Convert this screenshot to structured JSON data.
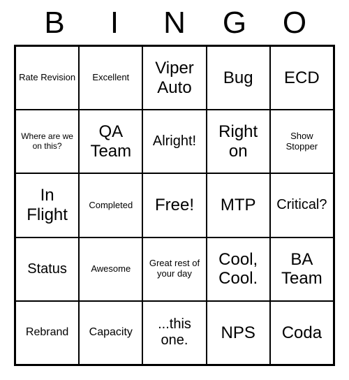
{
  "header": {
    "letters": [
      "B",
      "I",
      "N",
      "G",
      "O"
    ]
  },
  "grid": [
    [
      {
        "text": "Rate Revision",
        "size": "fs-s"
      },
      {
        "text": "Excellent",
        "size": "fs-s"
      },
      {
        "text": "Viper Auto",
        "size": "fs-xl"
      },
      {
        "text": "Bug",
        "size": "fs-xl"
      },
      {
        "text": "ECD",
        "size": "fs-xl"
      }
    ],
    [
      {
        "text": "Where are we on this?",
        "size": "fs-xs"
      },
      {
        "text": "QA Team",
        "size": "fs-xl"
      },
      {
        "text": "Alright!",
        "size": "fs-l"
      },
      {
        "text": "Right on",
        "size": "fs-xl"
      },
      {
        "text": "Show Stopper",
        "size": "fs-s"
      }
    ],
    [
      {
        "text": "In Flight",
        "size": "fs-xl"
      },
      {
        "text": "Completed",
        "size": "fs-s"
      },
      {
        "text": "Free!",
        "size": "fs-xl"
      },
      {
        "text": "MTP",
        "size": "fs-xl"
      },
      {
        "text": "Critical?",
        "size": "fs-l"
      }
    ],
    [
      {
        "text": "Status",
        "size": "fs-l"
      },
      {
        "text": "Awesome",
        "size": "fs-s"
      },
      {
        "text": "Great rest of your day",
        "size": "fs-s"
      },
      {
        "text": "Cool, Cool.",
        "size": "fs-xl"
      },
      {
        "text": "BA Team",
        "size": "fs-xl"
      }
    ],
    [
      {
        "text": "Rebrand",
        "size": "fs-m"
      },
      {
        "text": "Capacity",
        "size": "fs-m"
      },
      {
        "text": "...this one.",
        "size": "fs-l"
      },
      {
        "text": "NPS",
        "size": "fs-xl"
      },
      {
        "text": "Coda",
        "size": "fs-xl"
      }
    ]
  ]
}
